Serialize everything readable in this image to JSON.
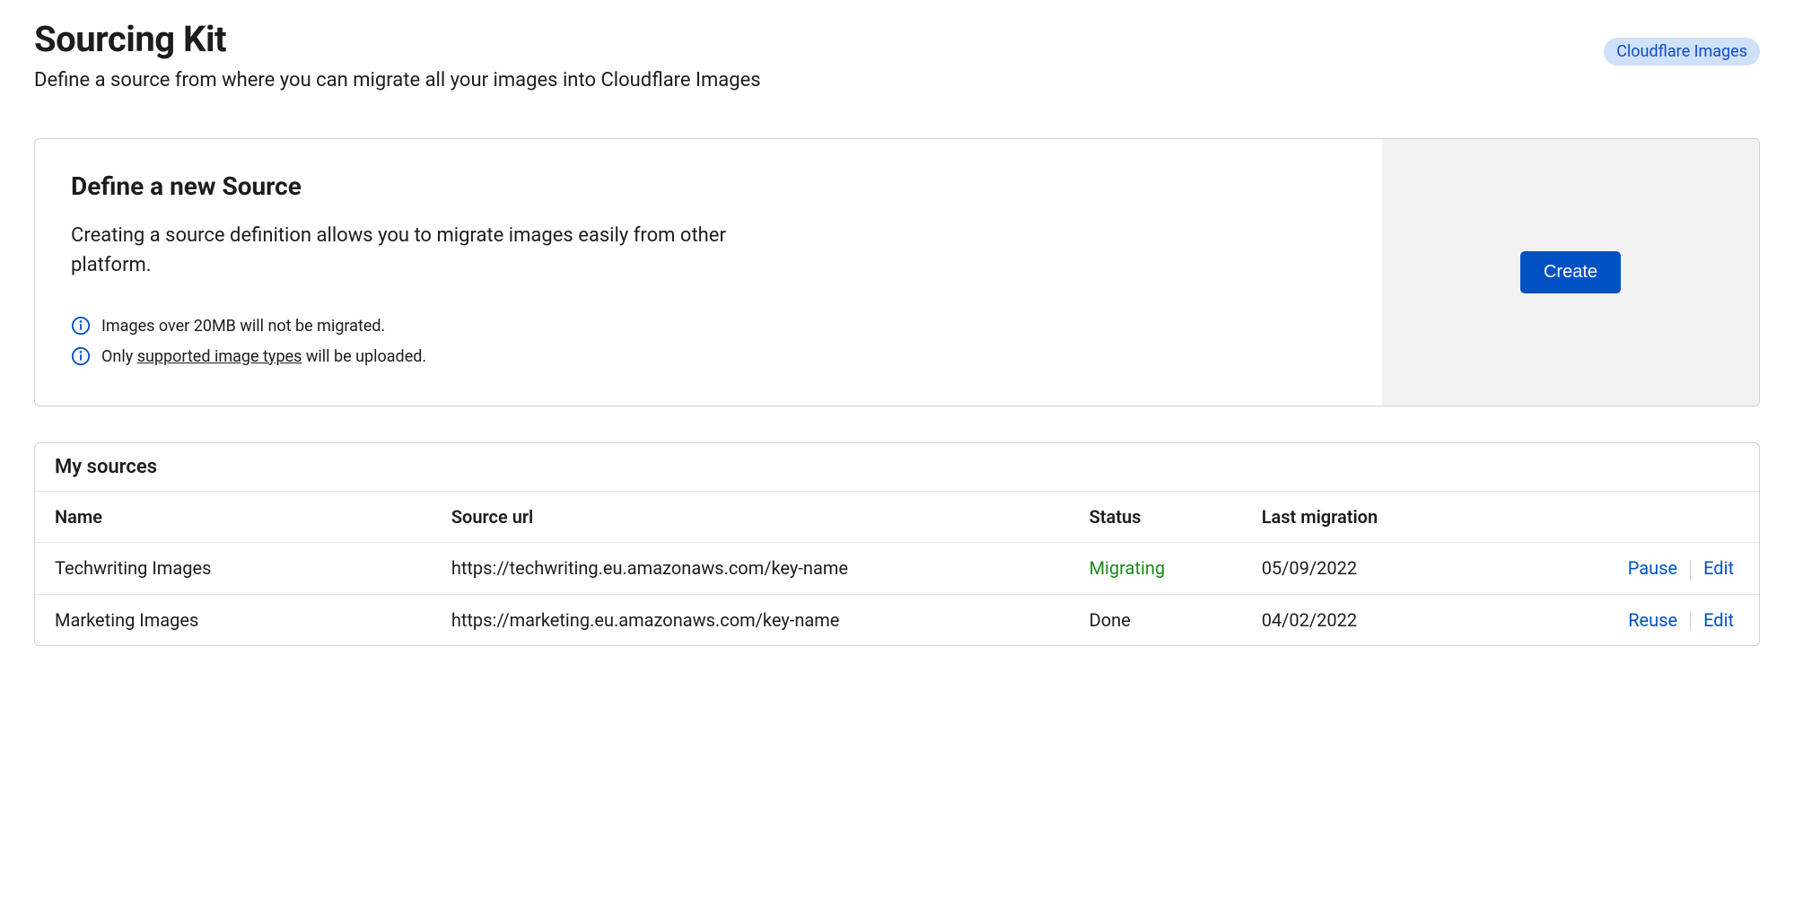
{
  "header": {
    "title": "Sourcing Kit",
    "subtitle": "Define a source from where you can migrate all your images into Cloudflare Images",
    "badge": "Cloudflare Images"
  },
  "define_panel": {
    "heading": "Define a new Source",
    "description": "Creating a source definition allows you to migrate images easily from other platform.",
    "info1": "Images over 20MB will not be migrated.",
    "info2_pre": "Only ",
    "info2_link": "supported image types",
    "info2_post": " will be uploaded.",
    "create_label": "Create"
  },
  "sources_table": {
    "title": "My sources",
    "columns": {
      "name": "Name",
      "url": "Source url",
      "status": "Status",
      "last": "Last migration"
    },
    "rows": [
      {
        "name": "Techwriting Images",
        "url": "https://techwriting.eu.amazonaws.com/key-name",
        "status": "Migrating",
        "status_class": "status-migrating",
        "last": "05/09/2022",
        "action_primary": "Pause",
        "action_secondary": "Edit"
      },
      {
        "name": "Marketing Images",
        "url": "https://marketing.eu.amazonaws.com/key-name",
        "status": "Done",
        "status_class": "status-done",
        "last": "04/02/2022",
        "action_primary": "Reuse",
        "action_secondary": "Edit"
      }
    ]
  }
}
